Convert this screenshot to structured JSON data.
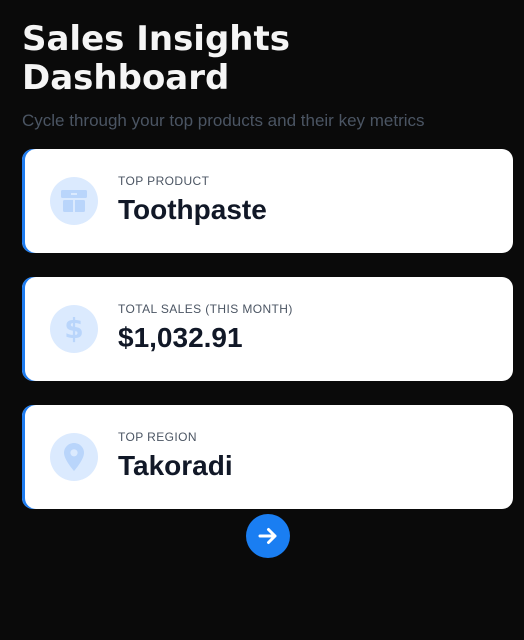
{
  "header": {
    "title": "Sales Insights Dashboard",
    "subtitle": "Cycle through your top products and their key metrics"
  },
  "cards": [
    {
      "label": "TOP PRODUCT",
      "value": "Toothpaste",
      "icon": "box-icon"
    },
    {
      "label": "TOTAL SALES (THIS MONTH)",
      "value": "$1,032.91",
      "icon": "dollar-icon"
    },
    {
      "label": "TOP REGION",
      "value": "Takoradi",
      "icon": "location-pin-icon"
    }
  ],
  "controls": {
    "next_icon": "arrow-right-icon"
  },
  "colors": {
    "background": "#0a0a0a",
    "card_background": "#ffffff",
    "accent": "#1e7cf0",
    "icon_circle": "#dbeafe",
    "icon_glyph": "#b9d5fb",
    "title": "#f5f5f5",
    "subtitle": "#4b5563"
  }
}
